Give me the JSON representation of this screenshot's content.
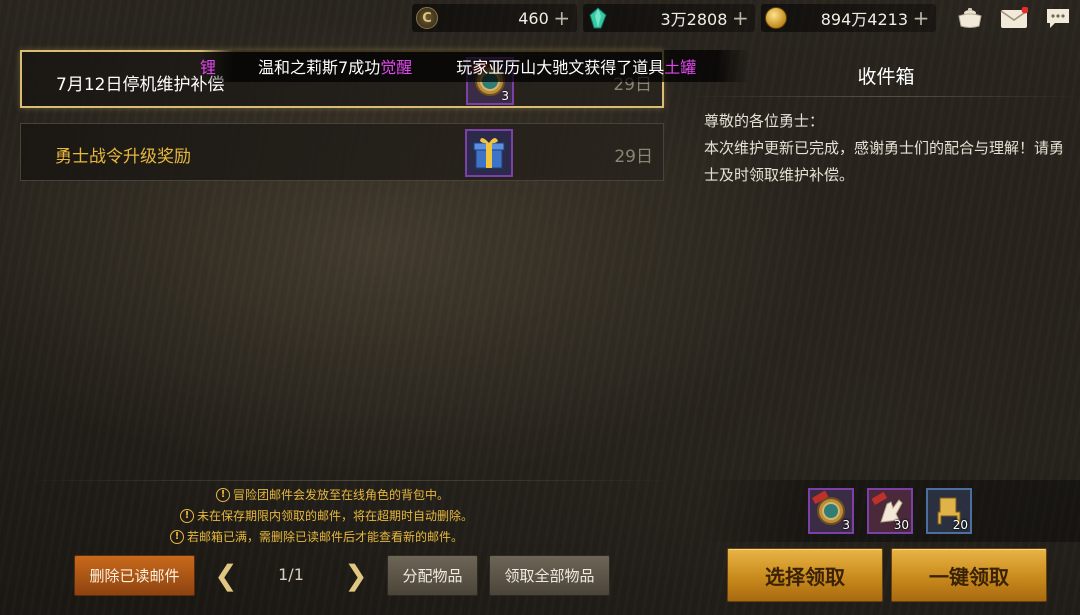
{
  "currencies": [
    {
      "icon": "gold-c-coin-icon",
      "value": "460"
    },
    {
      "icon": "green-crystal-icon",
      "value": "3万2808"
    },
    {
      "icon": "gold-coin-icon",
      "value": "894万4213"
    }
  ],
  "top_icons": [
    "shop-pot-icon",
    "mail-icon",
    "chat-icon"
  ],
  "broadcast": {
    "prefix": "锂",
    "msg1_text": "温和之莉斯7成功",
    "msg1_highlight": "觉醒",
    "msg2_text": "玩家亚历山大驰文获得了道具",
    "msg2_highlight": "土罐"
  },
  "mails": [
    {
      "title": "7月12日停机维护补偿",
      "thumb": "medal-icon",
      "thumb_count": "3",
      "days": "29日",
      "selected": true
    },
    {
      "title": "勇士战令升级奖励",
      "thumb": "gift-box-icon",
      "thumb_count": "",
      "days": "29日",
      "selected": false
    }
  ],
  "detail": {
    "header": "收件箱",
    "greeting": "尊敬的各位勇士：",
    "body": "本次维护更新已完成，感谢勇士们的配合与理解！请勇士及时领取维护补偿。"
  },
  "notes": [
    "冒险团邮件会发放至在线角色的背包中。",
    "未在保存期限内领取的邮件，将在超期时自动删除。",
    "若邮箱已满，需删除已读邮件后才能查看新的邮件。"
  ],
  "controls": {
    "delete_read": "删除已读邮件",
    "page": "1/1",
    "distribute": "分配物品",
    "collect_all_items": "领取全部物品",
    "select_collect": "选择领取",
    "one_key_collect": "一键领取"
  },
  "rewards": [
    {
      "icon": "medal-icon",
      "count": "3"
    },
    {
      "icon": "glove-ticket-icon",
      "count": "30"
    },
    {
      "icon": "golden-chair-icon",
      "count": "20"
    }
  ],
  "colors": {
    "gold_text": "#e7b83d",
    "highlight_magenta": "#e246f0",
    "selected_border": "#d9bd72",
    "rare_frame": "#7d3fa8"
  }
}
